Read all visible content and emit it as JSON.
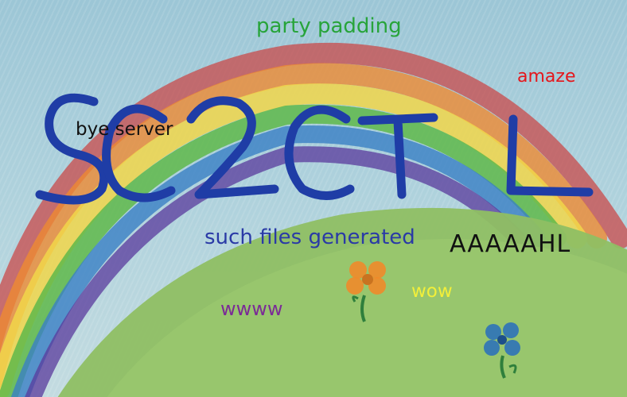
{
  "logo_text": "SC2CTL",
  "captions": {
    "party_padding": {
      "text": "party padding",
      "color": "#27a43a"
    },
    "amaze": {
      "text": "amaze",
      "color": "#e5161b"
    },
    "bye_server": {
      "text": "bye server",
      "color": "#111111"
    },
    "such_files_generated": {
      "text": "such files generated",
      "color": "#2a3aa6"
    },
    "aaaaahl": {
      "text": "AAAAAHL",
      "color": "#111111"
    },
    "wow": {
      "text": "wow",
      "color": "#f2ef3a"
    },
    "wwww": {
      "text": "wwww",
      "color": "#7b2b96"
    }
  },
  "colors": {
    "sky": "#a9cdd9",
    "hill": "#8fbf63",
    "logo": "#1f3da6",
    "rainbow": [
      "#c94a4a",
      "#ee8a32",
      "#f1d64a",
      "#5fb84a",
      "#3a7fc4",
      "#5a3a9c"
    ],
    "flower_orange": "#f08a2a",
    "flower_blue": "#2d72b8",
    "stem": "#2f7f3c"
  }
}
